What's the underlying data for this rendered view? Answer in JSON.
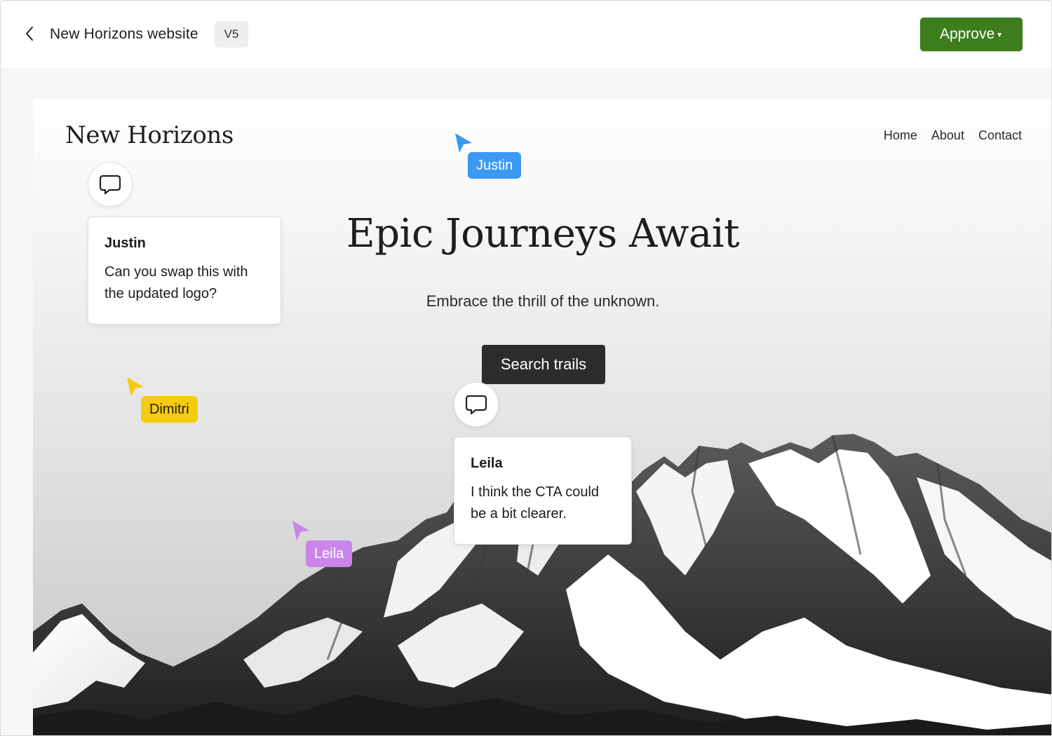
{
  "topbar": {
    "project_title": "New Horizons website",
    "version": "V5",
    "approve_label": "Approve",
    "approve_color": "#3d7d1c"
  },
  "site": {
    "logo": "New Horizons",
    "nav": [
      "Home",
      "About",
      "Contact"
    ],
    "hero_title": "Epic Journeys Await",
    "hero_subtitle": "Embrace the thrill of the unknown.",
    "cta_label": "Search trails"
  },
  "comments": [
    {
      "author": "Justin",
      "text": "Can you swap this with the updated logo?",
      "icon": "comment-icon"
    },
    {
      "author": "Leila",
      "text": "I think the CTA could be a bit clearer.",
      "icon": "comment-icon"
    }
  ],
  "cursors": [
    {
      "name": "Justin",
      "color": "#3b99f2",
      "text_color": "#ffffff"
    },
    {
      "name": "Dimitri",
      "color": "#f5cb12",
      "text_color": "#1d1d1d"
    },
    {
      "name": "Leila",
      "color": "#c986e8",
      "text_color": "#ffffff"
    }
  ]
}
